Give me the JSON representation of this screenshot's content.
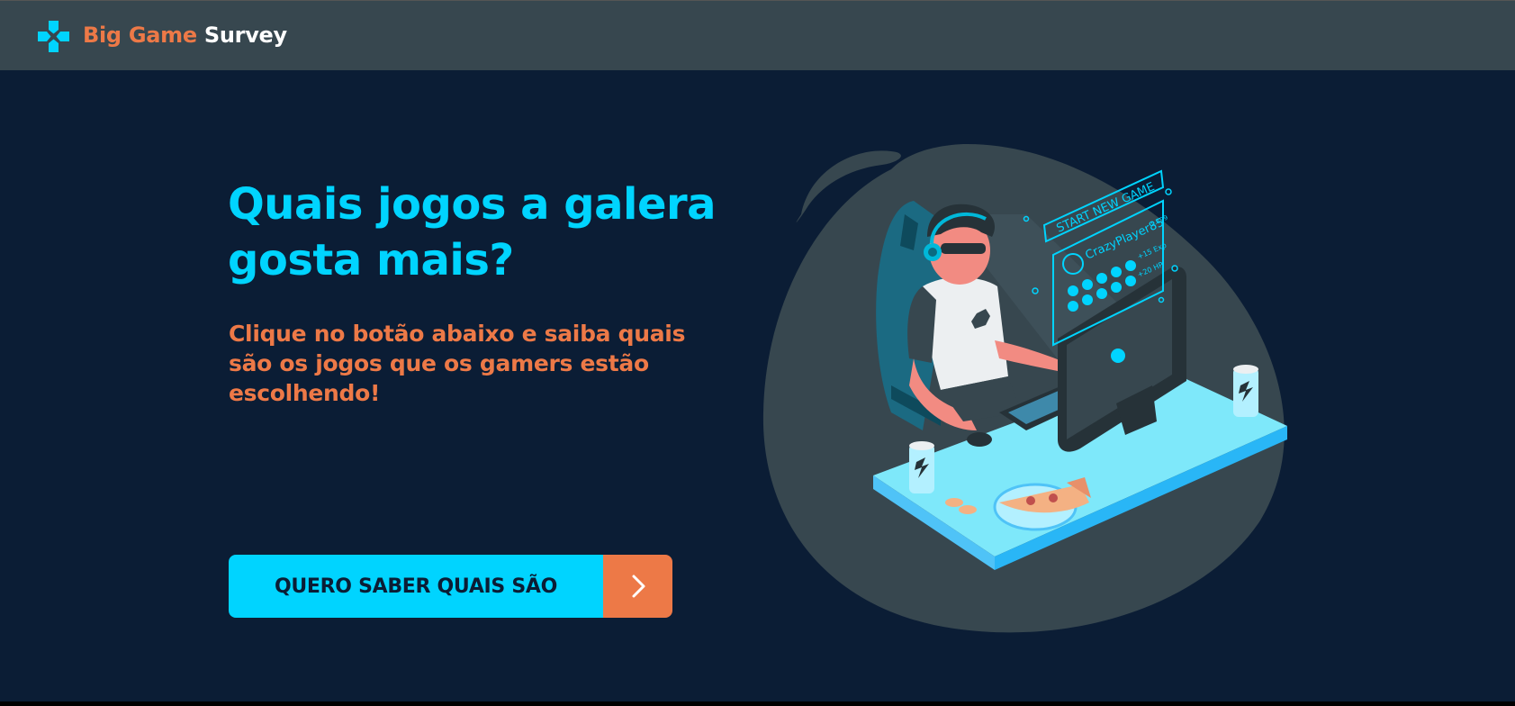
{
  "header": {
    "logo_icon": "gamepad-cross-icon",
    "brand_part1": "Big Game",
    "brand_part2": "Survey"
  },
  "hero": {
    "headline": "Quais jogos a galera gosta mais?",
    "subtitle": "Clique no botão abaixo e saiba quais são os jogos que os gamers estão escolhendo!",
    "cta_label": "QUERO SABER QUAIS SÃO",
    "cta_icon": "chevron-right-icon"
  },
  "illustration": {
    "screen_title": "START NEW GAME",
    "player_name": "CrazyPlayer85",
    "level": "L.199",
    "exp": "+15 Exp",
    "hp": "+20 HP"
  },
  "colors": {
    "background": "#0b1d35",
    "topbar": "#37474f",
    "primary": "#00d4ff",
    "accent": "#ed7947"
  }
}
